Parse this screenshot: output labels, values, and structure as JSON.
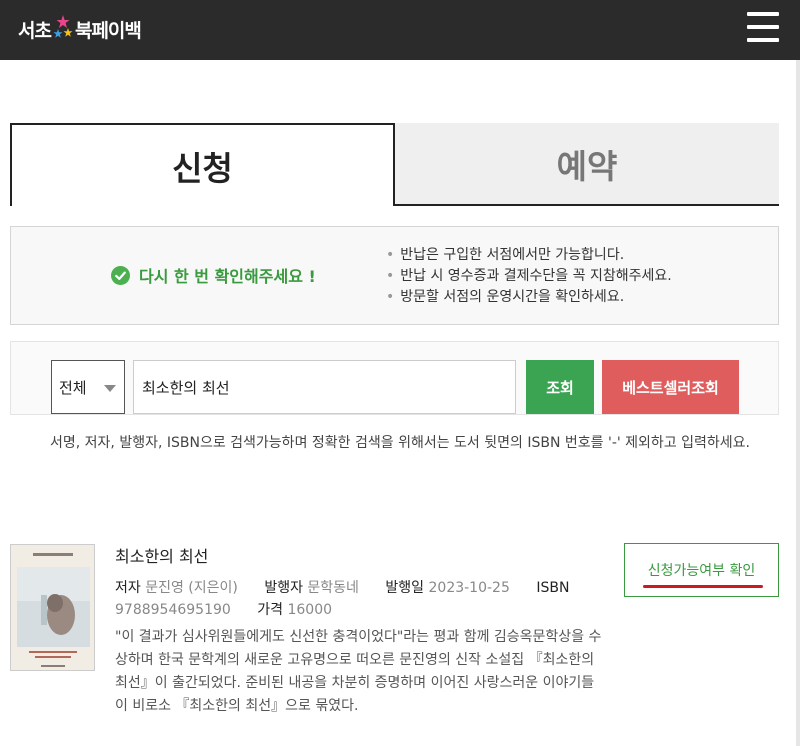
{
  "header": {
    "logo_part1": "서초",
    "logo_part2": "북페이백",
    "colors": {
      "bar": "#2b2b2b",
      "star_pink": "#e8458b",
      "star_blue": "#3aa0e8",
      "star_yellow": "#f2c21b"
    }
  },
  "tabs": [
    {
      "label": "신청",
      "active": true
    },
    {
      "label": "예약",
      "active": false
    }
  ],
  "notice": {
    "message": "다시 한 번 확인해주세요 !",
    "items": [
      "반납은 구입한 서점에서만 가능합니다.",
      "반납 시 영수증과 결제수단을 꼭 지참해주세요.",
      "방문할 서점의 운영시간을 확인하세요."
    ]
  },
  "search": {
    "select_value": "전체",
    "query": "최소한의 최선",
    "search_label": "조회",
    "bestseller_label": "베스트셀러조회",
    "help": "서명, 저자, 발행자, ISBN으로 검색가능하며 정확한 검색을 위해서는 도서 뒷면의 ISBN 번호를 '-' 제외하고 입력하세요."
  },
  "result": {
    "title": "최소한의 최선",
    "author_label": "저자",
    "author": "문진영 (지은이)",
    "publisher_label": "발행자",
    "publisher": "문학동네",
    "date_label": "발행일",
    "date": "2023-10-25",
    "isbn_label": "ISBN",
    "isbn": "9788954695190",
    "price_label": "가격",
    "price": "16000",
    "description": "\"이 결과가 심사위원들에게도 신선한 충격이었다\"라는 평과 함께 김승옥문학상을 수상하며 한국 문학계의 새로운 고유명으로 떠오른 문진영의 신작 소설집 『최소한의 최선』이 출간되었다. 준비된 내공을 차분히 증명하며 이어진 사랑스러운 이야기들이 비로소 『최소한의 최선』으로 묶였다.",
    "check_label": "신청가능여부 확인"
  }
}
